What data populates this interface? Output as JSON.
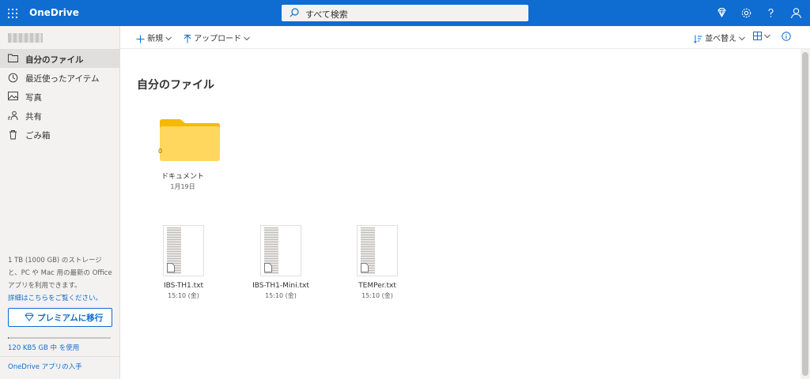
{
  "topbar": {
    "brand": "OneDrive",
    "search_placeholder": "すべて検索"
  },
  "sidebar": {
    "items": [
      {
        "label": "自分のファイル",
        "icon": "folder-icon",
        "active": true
      },
      {
        "label": "最近使ったアイテム",
        "icon": "history-icon"
      },
      {
        "label": "写真",
        "icon": "photo-icon"
      },
      {
        "label": "共有",
        "icon": "share-icon"
      },
      {
        "label": "ごみ箱",
        "icon": "trash-icon"
      }
    ],
    "storage_desc": "1 TB (1000 GB) のストレージと、PC や Mac 用の最新の Office アプリを利用できます。",
    "details_link": "詳細はこちらをご覧ください。",
    "premium_button": "プレミアムに移行",
    "storage_used": "120 KB5 GB 中 を使用",
    "storage_used_fraction": 0.001,
    "app_link": "OneDrive アプリの入手"
  },
  "commandbar": {
    "new_label": "新規",
    "upload_label": "アップロード",
    "sort_label": "並べ替え"
  },
  "main": {
    "title": "自分のファイル",
    "folder": {
      "name": "ドキュメント",
      "date": "1月19日",
      "count": "0"
    },
    "files": [
      {
        "name": "IBS-TH1.txt",
        "date": "15:10 (金)"
      },
      {
        "name": "IBS-TH1-Mini.txt",
        "date": "15:10 (金)"
      },
      {
        "name": "TEMPer.txt",
        "date": "15:10 (金)"
      }
    ]
  },
  "colors": {
    "accent": "#0f6cd0",
    "folder": "#ffd75e",
    "folder_tab": "#f6b900"
  }
}
